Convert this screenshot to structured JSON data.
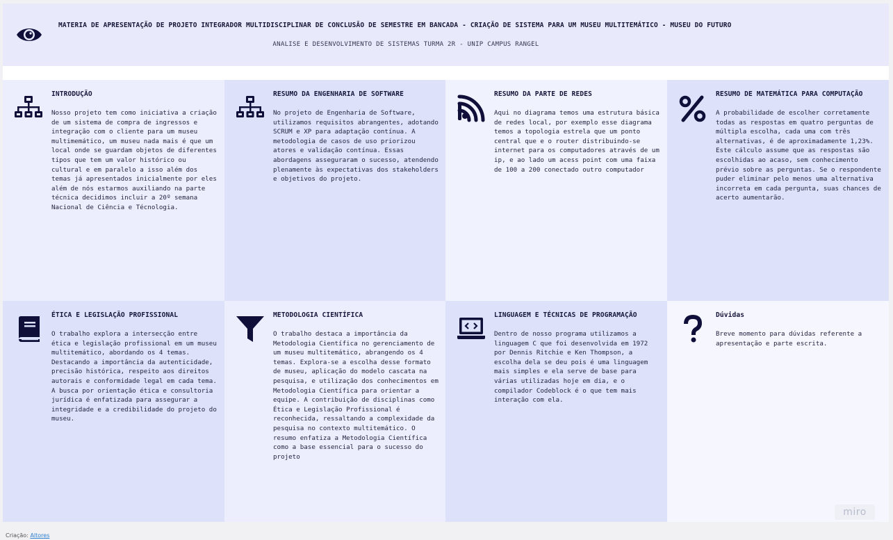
{
  "header": {
    "title": "MATERIA DE APRESENTAÇÃO DE PROJETO INTEGRADOR MULTIDISCIPLINAR DE CONCLUSÃO DE SEMESTRE EM BANCADA - CRIAÇÃO DE SISTEMA PARA UM MUSEU MULTITEMÁTICO - MUSEU DO FUTURO",
    "subtitle": "ANALISE E DESENVOLVIMENTO DE SISTEMAS TURMA 2R - UNIP CAMPUS RANGEL",
    "icon": "eye-icon"
  },
  "cards": [
    {
      "icon": "sitemap-icon",
      "title": "INTRODUÇÃO",
      "body": "Nosso projeto tem como iniciativa a criação de um sistema de compra de ingressos e integração com o cliente para um museu multimemático, um museu nada mais é que um local onde se guardam objetos de diferentes tipos que tem um valor histórico ou cultural e em paralelo a isso além dos temas já apresentados inicialmente por eles além de nós estarmos auxiliando na parte técnica decidimos incluir a 20º semana Nacional de Ciência e Técnologia."
    },
    {
      "icon": "sitemap-icon",
      "title": "RESUMO DA ENGENHARIA DE SOFTWARE",
      "body": "No projeto de Engenharia de Software, utilizamos requisitos abrangentes, adotando SCRUM e XP para adaptação contínua. A metodologia de casos de uso priorizou atores e validação contínua. Essas abordagens asseguraram o sucesso, atendendo plenamente às expectativas dos stakeholders e objetivos do projeto."
    },
    {
      "icon": "rss-icon",
      "title": "RESUMO DA PARTE DE REDES",
      "body": "Aqui no diagrama temos uma estrutura básica de redes local, por exemplo esse diagrama temos a topologia estrela que um ponto central que e o router distribuindo-se internet para os computadores através de um ip, e ao lado um acess point com uma faixa de 100 a 200 conectado outro computador"
    },
    {
      "icon": "percent-icon",
      "title": "RESUMO DE MATEMÁTICA PARA COMPUTAÇÃO",
      "body": "A probabilidade de escolher corretamente todas as respostas em quatro perguntas de múltipla escolha, cada uma com três alternativas, é de aproximadamente 1,23%. Este cálculo assume que as respostas são escolhidas ao acaso, sem conhecimento prévio sobre as perguntas. Se o respondente puder eliminar pelo menos uma alternativa incorreta em cada pergunta, suas chances de acerto aumentarão."
    },
    {
      "icon": "book-icon",
      "title": "ÉTICA E LEGISLAÇÃO PROFISSIONAL",
      "body": "O trabalho explora a intersecção entre ética e legislação profissional em um museu multitemático, abordando os 4 temas. Destacando a importância da autenticidade, precisão histórica, respeito aos direitos autorais e conformidade legal em cada tema. A busca por orientação ética e consultoria jurídica é enfatizada para assegurar a integridade e a credibilidade do projeto do museu."
    },
    {
      "icon": "filter-icon",
      "title": "METODOLOGIA CIENTÍFICA",
      "body": "O trabalho destaca a importância da Metodologia Científica no gerenciamento de um museu multitemático, abrangendo os 4 temas. Explora-se a escolha desse formato de museu, aplicação do modelo cascata na pesquisa, e utilização dos conhecimentos em Metodologia Científica para orientar a equipe. A contribuição de disciplinas como Ética e Legislação Profissional é reconhecida, ressaltando a complexidade da pesquisa no contexto multitemático. O resumo enfatiza a Metodologia Científica como a base essencial para o sucesso do projeto"
    },
    {
      "icon": "laptop-code-icon",
      "title": "LINGUAGEM E TÉCNICAS DE PROGRAMAÇÃO",
      "body": "Dentro de nosso programa utilizamos a linguagem C que foi desenvolvida em 1972 por Dennis Ritchie e Ken Thompson, a escolha dela se deu pois é uma linguagem mais simples e ela serve de base para várias utilizadas hoje em dia, e o compilador Codeblock é o que tem mais interação com ela."
    },
    {
      "icon": "question-icon",
      "title": "Dúvidas",
      "body": "Breve momento para dúvidas referente a apresentação e parte escrita."
    }
  ],
  "watermark": "miro",
  "footer": {
    "prefix": "Criação:",
    "link": "Altores"
  }
}
